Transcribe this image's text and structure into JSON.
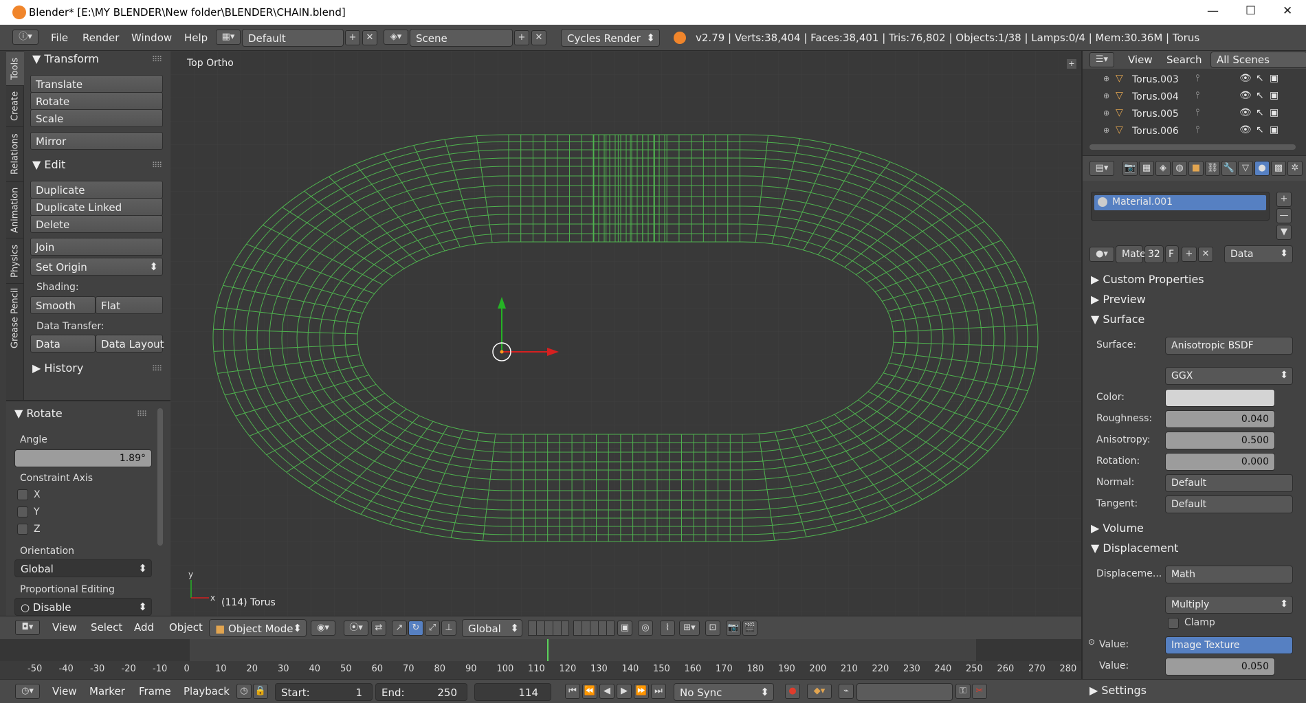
{
  "window": {
    "title": "Blender* [E:\\MY BLENDER\\New folder\\BLENDER\\CHAIN.blend]",
    "min": "—",
    "max": "☐",
    "close": "✕"
  },
  "menu": {
    "items": [
      "File",
      "Render",
      "Window",
      "Help"
    ],
    "layout": "Default",
    "scene": "Scene",
    "engine": "Cycles Render",
    "stats": "v2.79 | Verts:38,404 | Faces:38,401 | Tris:76,802 | Objects:1/38 | Lamps:0/4 | Mem:30.36M | Torus"
  },
  "tool_tabs": [
    "Tools",
    "Create",
    "Relations",
    "Animation",
    "Physics",
    "Grease Pencil"
  ],
  "tools": {
    "transform_header": "Transform",
    "translate": "Translate",
    "rotate": "Rotate",
    "scale": "Scale",
    "mirror": "Mirror",
    "edit_header": "Edit",
    "duplicate": "Duplicate",
    "duplicate_linked": "Duplicate Linked",
    "delete": "Delete",
    "join": "Join",
    "set_origin": "Set Origin",
    "shading_label": "Shading:",
    "smooth": "Smooth",
    "flat": "Flat",
    "data_transfer_label": "Data Transfer:",
    "data": "Data",
    "data_layout": "Data Layout",
    "history_header": "History"
  },
  "operator": {
    "header": "Rotate",
    "angle_label": "Angle",
    "angle_value": "1.89°",
    "constraint_label": "Constraint Axis",
    "axes": [
      "X",
      "Y",
      "Z"
    ],
    "orientation_label": "Orientation",
    "orientation": "Global",
    "prop_label": "Proportional Editing",
    "prop_value": "Disable"
  },
  "viewport": {
    "view_name": "Top Ortho",
    "object_info": "(114) Torus",
    "axis_x": "x",
    "axis_y": "y"
  },
  "view_header": {
    "menus": [
      "View",
      "Select",
      "Add",
      "Object"
    ],
    "mode": "Object Mode",
    "orientation": "Global"
  },
  "timeline": {
    "ticks": [
      "-50",
      "-40",
      "-30",
      "-20",
      "-10",
      "0",
      "10",
      "20",
      "30",
      "40",
      "50",
      "60",
      "70",
      "80",
      "90",
      "100",
      "110",
      "120",
      "130",
      "140",
      "150",
      "160",
      "170",
      "180",
      "190",
      "200",
      "210",
      "220",
      "230",
      "240",
      "250",
      "260",
      "270",
      "280"
    ],
    "current_frame": 114
  },
  "tl_header": {
    "menus": [
      "View",
      "Marker",
      "Frame",
      "Playback"
    ],
    "start_label": "Start:",
    "start": "1",
    "end_label": "End:",
    "end": "250",
    "frame": "114",
    "sync": "No Sync"
  },
  "outliner": {
    "menus": [
      "View",
      "Search"
    ],
    "filter": "All Scenes",
    "items": [
      "Torus.003",
      "Torus.004",
      "Torus.005",
      "Torus.006"
    ]
  },
  "props": {
    "material_slot": "Material.001",
    "mat_name": "Mate",
    "users": "32",
    "fake": "F",
    "link": "Data",
    "custom_properties": "Custom Properties",
    "preview": "Preview",
    "surface_header": "Surface",
    "surface_label": "Surface:",
    "surface_value": "Anisotropic BSDF",
    "distribution": "GGX",
    "color_label": "Color:",
    "roughness_label": "Roughness:",
    "roughness": "0.040",
    "anisotropy_label": "Anisotropy:",
    "anisotropy": "0.500",
    "rotation_label": "Rotation:",
    "rotation": "0.000",
    "normal_label": "Normal:",
    "normal": "Default",
    "tangent_label": "Tangent:",
    "tangent": "Default",
    "volume": "Volume",
    "displacement_header": "Displacement",
    "displacement_label": "Displaceme...",
    "displacement_value": "Math",
    "operation": "Multiply",
    "clamp": "Clamp",
    "value_label": "Value:",
    "value_link": "Image Texture",
    "value2_label": "Value:",
    "value2": "0.050",
    "settings": "Settings"
  },
  "colors": {
    "wire": "#4fb34f",
    "accent": "#5680c2",
    "bg": "#393939"
  }
}
